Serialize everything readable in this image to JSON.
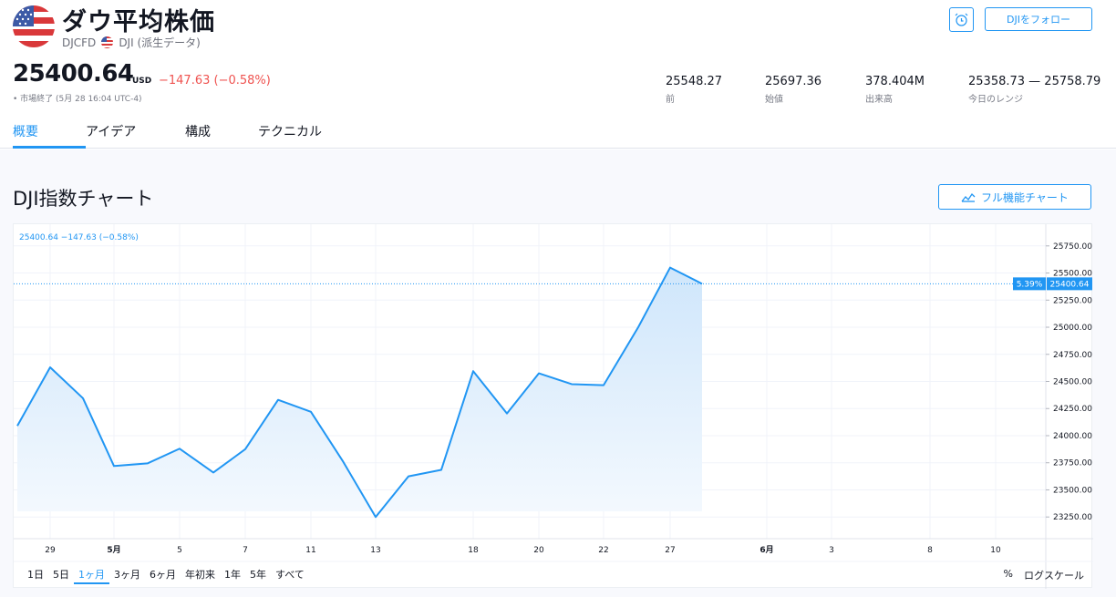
{
  "header": {
    "title": "ダウ平均株価",
    "symbol": "DJCFD",
    "exchange": "DJI (派生データ)",
    "follow_label": "DJIをフォロー",
    "price": "25400.64",
    "currency": "USD",
    "change": "−147.63 (−0.58%)",
    "market_status": "• 市場終了 (5月 28 16:04 UTC-4)"
  },
  "stats": [
    {
      "value": "25548.27",
      "label": "前"
    },
    {
      "value": "25697.36",
      "label": "始値"
    },
    {
      "value": "378.404M",
      "label": "出来高"
    },
    {
      "value": "25358.73 — 25758.79",
      "label": "今日のレンジ"
    }
  ],
  "tabs": [
    {
      "label": "概要",
      "active": true
    },
    {
      "label": "アイデア",
      "active": false
    },
    {
      "label": "構成",
      "active": false
    },
    {
      "label": "テクニカル",
      "active": false
    }
  ],
  "chart_section": {
    "title": "DJI指数チャート",
    "full_button_label": "フル機能チャート",
    "legend": "25400.64  −147.63 (−0.58%)"
  },
  "chart_data": {
    "type": "area",
    "x": [
      "4/28",
      "4/29",
      "4/30",
      "5/1",
      "5/4",
      "5/5",
      "5/6",
      "5/7",
      "5/8",
      "5/11",
      "5/12",
      "5/13",
      "5/14",
      "5/15",
      "5/18",
      "5/19",
      "5/20",
      "5/21",
      "5/22",
      "5/26",
      "5/27",
      "5/28"
    ],
    "values": [
      24090,
      24630,
      24345,
      23720,
      23745,
      23880,
      23660,
      23875,
      24330,
      24220,
      23765,
      23250,
      23625,
      23685,
      24595,
      24205,
      24575,
      24475,
      24465,
      25000,
      25550,
      25400.64
    ],
    "ylim": [
      23050,
      25950
    ],
    "y_ticks": [
      "23250.00",
      "23500.00",
      "23750.00",
      "24000.00",
      "24250.00",
      "24500.00",
      "24750.00",
      "25000.00",
      "25250.00",
      "25500.00",
      "25750.00"
    ],
    "x_ticks": [
      "29",
      "5月",
      "5",
      "7",
      "11",
      "13",
      "18",
      "20",
      "22",
      "27",
      "6月",
      "3",
      "8",
      "10"
    ],
    "last_value_label": "25400.64",
    "percent_label": "5.39%",
    "colors": {
      "line": "#2196f3",
      "fill_top": "#cfe6fb",
      "fill_bottom": "#f4f9fe"
    }
  },
  "ranges": [
    {
      "label": "1日",
      "active": false
    },
    {
      "label": "5日",
      "active": false
    },
    {
      "label": "1ヶ月",
      "active": true
    },
    {
      "label": "3ヶ月",
      "active": false
    },
    {
      "label": "6ヶ月",
      "active": false
    },
    {
      "label": "年初来",
      "active": false
    },
    {
      "label": "1年",
      "active": false
    },
    {
      "label": "5年",
      "active": false
    },
    {
      "label": "すべて",
      "active": false
    }
  ],
  "scale_options": {
    "percent": "%",
    "log": "ログスケール"
  }
}
